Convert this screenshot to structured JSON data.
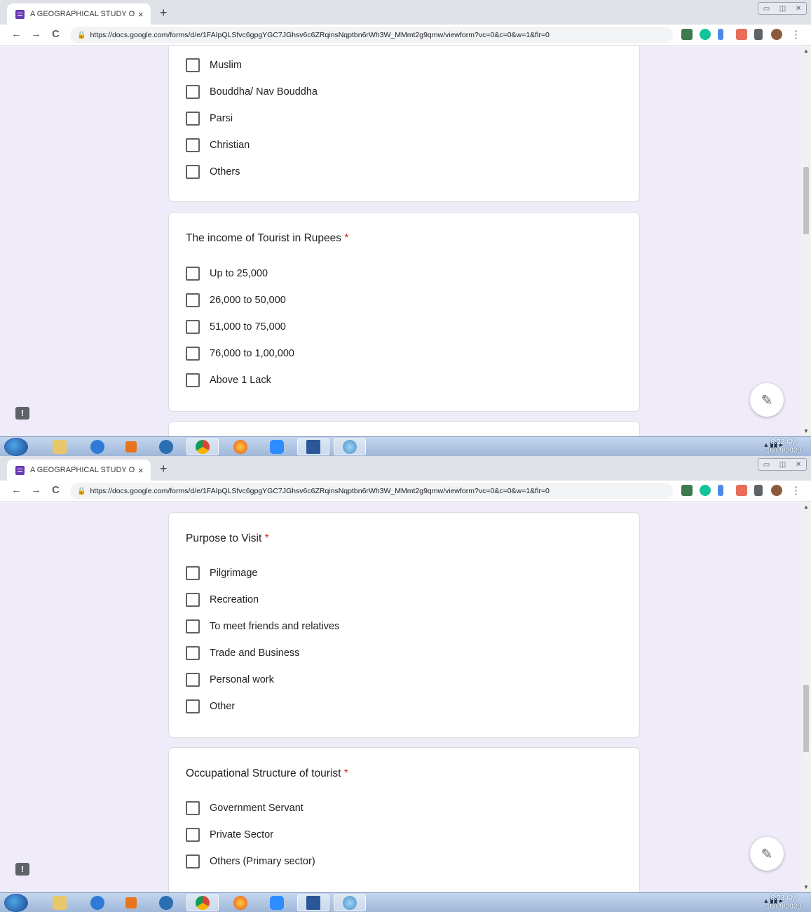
{
  "browser": {
    "tab_title": "A GEOGRAPHICAL STUDY OF TO",
    "tab_close": "×",
    "new_tab": "+",
    "url": "https://docs.google.com/forms/d/e/1FAIpQLSfvc6gpgYGC7JGhsv6c6ZRqinsNqptbn6rWh3W_MMmt2g9qmw/viewform?vc=0&c=0&w=1&flr=0",
    "back": "←",
    "forward": "→",
    "reload": "C",
    "lock": "🔒",
    "menu": "⋮",
    "window_controls": [
      "▭",
      "◫",
      "✕"
    ]
  },
  "screen1": {
    "religion_options": [
      "Muslim",
      "Bouddha/ Nav Bouddha",
      "Parsi",
      "Christian",
      "Others"
    ],
    "income_question": {
      "title": "The income of Tourist in Rupees",
      "required_mark": "*",
      "options": [
        "Up to 25,000",
        "26,000 to 50,000",
        "51,000 to 75,000",
        "76,000 to 1,00,000",
        "Above 1 Lack"
      ]
    },
    "clock_time": "8:22 AM",
    "clock_date": "16/09/2020"
  },
  "screen2": {
    "purpose_question": {
      "title": "Purpose to Visit",
      "required_mark": "*",
      "options": [
        "Pilgrimage",
        "Recreation",
        "To meet friends and relatives",
        "Trade and Business",
        "Personal work",
        "Other"
      ]
    },
    "occupation_question": {
      "title": "Occupational Structure of tourist",
      "required_mark": "*",
      "options": [
        "Government Servant",
        "Private Sector",
        "Others (Primary sector)"
      ]
    },
    "clock_time": "8:23 AM",
    "clock_date": "16/09/2020"
  },
  "ui": {
    "edit_icon": "✎",
    "feedback_icon": "!",
    "scroll_up": "▲",
    "scroll_down": "▼"
  },
  "taskbar": {
    "items": [
      "start-orb",
      "windows-explorer",
      "internet-explorer",
      "media-player",
      "search-app",
      "chrome",
      "firefox",
      "zoom",
      "word",
      "paint"
    ]
  },
  "colors": {
    "form_background": "#f0ebf8",
    "forms_brand": "#673ab7",
    "required": "#d93025"
  }
}
